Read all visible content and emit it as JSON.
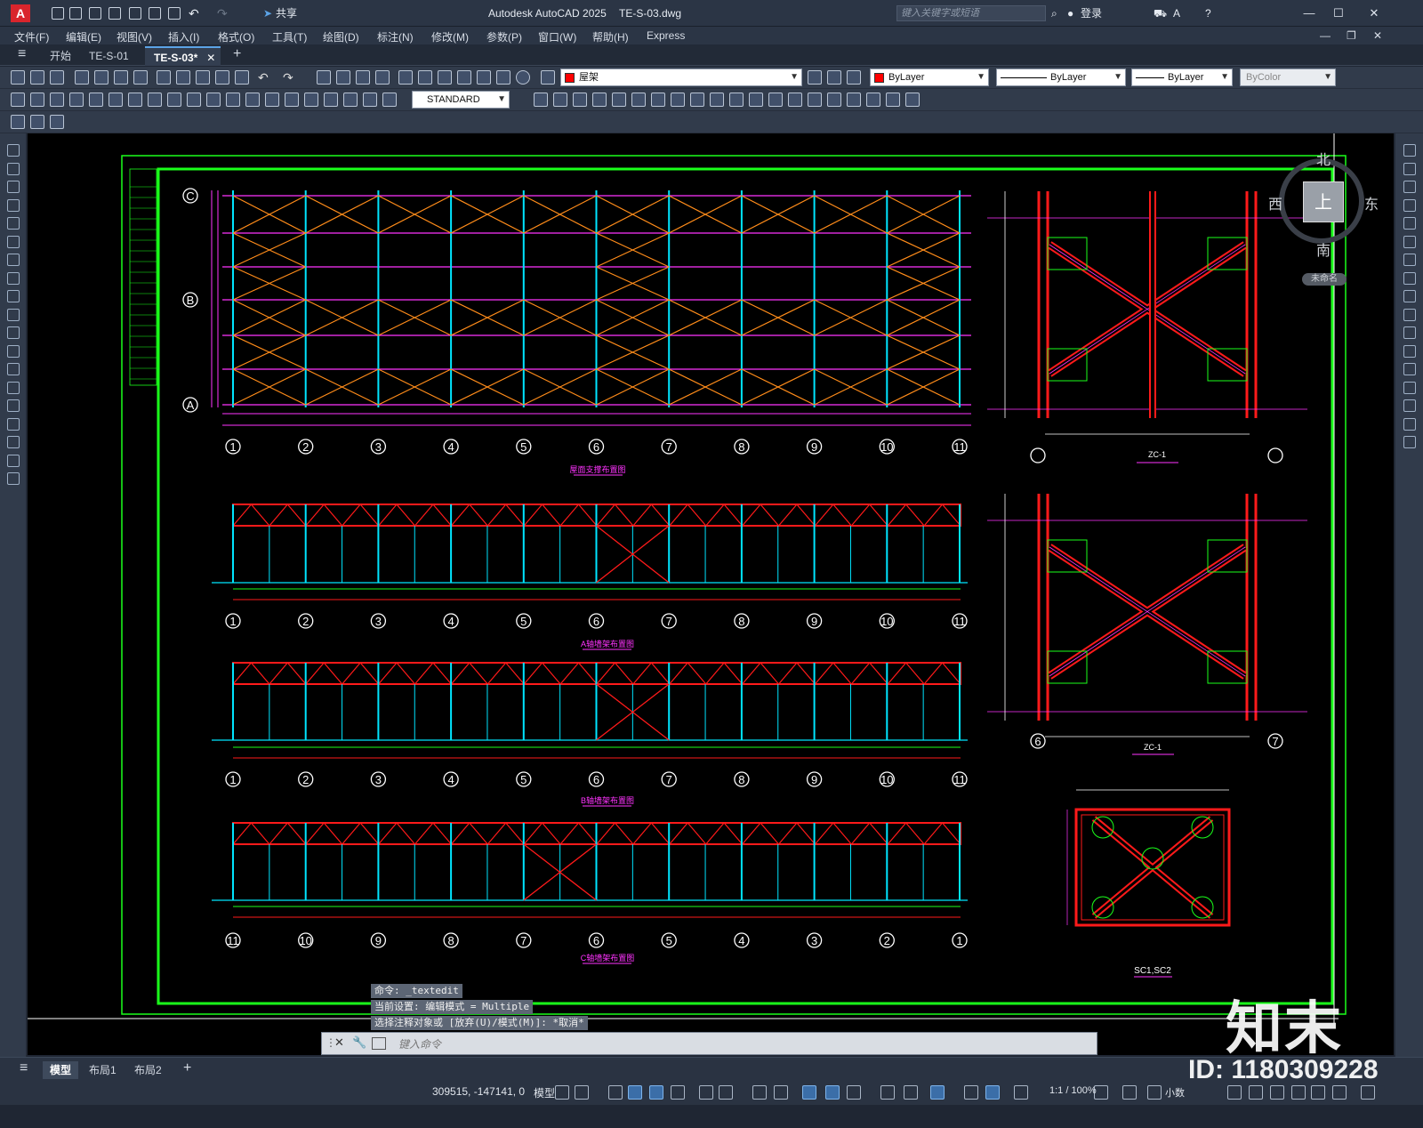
{
  "titlebar": {
    "app_title": "Autodesk AutoCAD 2025",
    "file_title": "TE-S-03.dwg",
    "share_label": "共享",
    "search_placeholder": "键入关键字或短语",
    "login_label": "登录"
  },
  "menubar": {
    "items": [
      "文件(F)",
      "编辑(E)",
      "视图(V)",
      "插入(I)",
      "格式(O)",
      "工具(T)",
      "绘图(D)",
      "标注(N)",
      "修改(M)",
      "参数(P)",
      "窗口(W)",
      "帮助(H)",
      "Express"
    ]
  },
  "tabs": {
    "items": [
      "开始",
      "TE-S-01",
      "TE-S-03*"
    ]
  },
  "toolbar": {
    "layer_name": "屋架",
    "color": "ByLayer",
    "linetype": "ByLayer",
    "lineweight": "ByLayer",
    "plotstyle": "ByColor",
    "textstyle": "STANDARD"
  },
  "viewcube": {
    "north": "北",
    "south": "南",
    "east": "东",
    "west": "西",
    "top": "上",
    "wcs": "未命名"
  },
  "drawing": {
    "plan_title": "屋面支撑布置图",
    "elev_a_title": "A轴墙架布置图",
    "elev_b_title": "B轴墙架布置图",
    "elev_c_title": "C轴墙架布置图",
    "detail1_title": "ZC-1",
    "detail2_title": "ZC-1",
    "detail3_title": "SC1,SC2",
    "row_labels": [
      "C",
      "B",
      "A"
    ],
    "axis_numbers": [
      "1",
      "2",
      "3",
      "4",
      "5",
      "6",
      "7",
      "8",
      "9",
      "10",
      "11"
    ],
    "axis_numbers_rev": [
      "11",
      "10",
      "9",
      "8",
      "7",
      "6",
      "5",
      "4",
      "3",
      "2",
      "1"
    ],
    "detail2_axes": [
      "6",
      "7"
    ]
  },
  "command": {
    "history": [
      "命令: _textedit",
      "当前设置: 编辑模式 = Multiple",
      "选择注释对象或 [放弃(U)/模式(M)]: *取消*"
    ],
    "placeholder": "键入命令"
  },
  "layouts": {
    "items": [
      "模型",
      "布局1",
      "布局2"
    ]
  },
  "status": {
    "coords": "309515, -147141, 0",
    "space": "模型",
    "scale": "1:1 / 100%",
    "units": "小数"
  },
  "watermark": {
    "brand": "知末",
    "id": "ID: 1180309228"
  },
  "colors": {
    "red": "#ff1a1a",
    "cyan": "#00e5ff",
    "orange": "#ff8c1a",
    "green": "#1aff1a",
    "magenta": "#ff33ff",
    "white": "#ffffff"
  }
}
